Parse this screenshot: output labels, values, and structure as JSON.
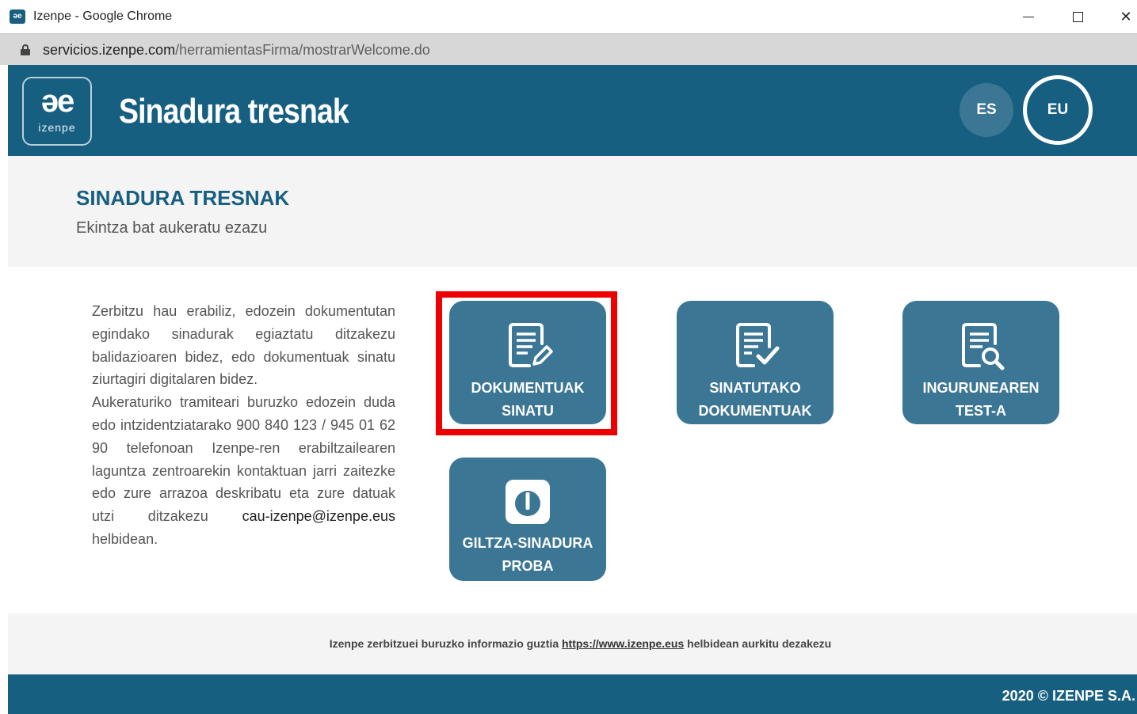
{
  "window": {
    "favicon_text": "əe",
    "title": "Izenpe - Google Chrome",
    "minimize_symbol": "—",
    "close_symbol": "✕"
  },
  "browser": {
    "url_domain": "servicios.izenpe.com",
    "url_path": "/herramientasFirma/mostrarWelcome.do"
  },
  "header": {
    "logo_mark": "əe",
    "logo_text": "izenpe",
    "title": "Sinadura tresnak",
    "languages": [
      {
        "code": "ES",
        "active": false
      },
      {
        "code": "EU",
        "active": true
      }
    ]
  },
  "intro": {
    "title": "SINADURA TRESNAK",
    "subtitle": "Ekintza bat aukeratu ezazu"
  },
  "description": {
    "text": "Zerbitzu hau erabiliz, edozein dokumentutan egindako sinadurak egiaztatu ditzakezu balidazioaren bidez, edo dokumentuak sinatu ziurtagiri digitalaren bidez.",
    "text2": "Aukeraturiko tramiteari buruzko edozein duda edo intzidentziatarako 900 840 123 / 945 01 62 90 telefonoan Izenpe-ren erabiltzailearen laguntza zentroarekin kontaktuan jarri zaitezke edo zure arrazoa deskribatu eta zure datuak utzi ditzakezu",
    "email": "cau-izenpe@izenpe.eus",
    "text3": "helbidean."
  },
  "actions": [
    {
      "line1": "DOKUMENTUAK",
      "line2": "SINATU",
      "icon": "document-sign-icon",
      "highlighted": true
    },
    {
      "line1": "SINATUTAKO",
      "line2": "DOKUMENTUAK",
      "icon": "document-check-icon",
      "highlighted": false
    },
    {
      "line1": "INGURUNEAREN",
      "line2": "TEST-A",
      "icon": "document-search-icon",
      "highlighted": false
    },
    {
      "line1": "GILTZA-SINADURA",
      "line2": "PROBA",
      "icon": "giltza-icon",
      "highlighted": false
    }
  ],
  "footer": {
    "info_prefix": "Izenpe zerbitzuei buruzko informazio guztia",
    "info_link": "https://www.izenpe.eus",
    "info_suffix": "helbidean aurkitu dezakezu",
    "copyright": "2020 © IZENPE S.A."
  },
  "colors": {
    "brand": "#175f80",
    "tile": "#3b7694",
    "highlight": "#ee0000"
  }
}
